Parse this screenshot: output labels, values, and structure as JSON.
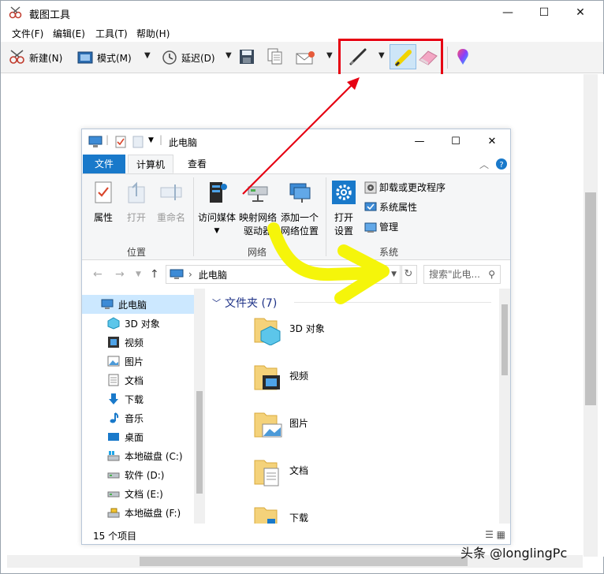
{
  "snip": {
    "title": "截图工具",
    "menu": [
      "文件(F)",
      "编辑(E)",
      "工具(T)",
      "帮助(H)"
    ],
    "toolbar": {
      "new_label": "新建(N)",
      "mode_label": "模式(M)",
      "delay_label": "延迟(D)"
    }
  },
  "explorer": {
    "title": "此电脑",
    "tabs": {
      "file": "文件",
      "computer": "计算机",
      "view": "查看"
    },
    "ribbon": {
      "properties": "属性",
      "open": "打开",
      "rename": "重命名",
      "group_location": "位置",
      "access_media_1": "访问媒体",
      "map_drive_1": "映射网络",
      "map_drive_2": "驱动器",
      "add_netloc_1": "添加一个",
      "add_netloc_2": "网络位置",
      "group_network": "网络",
      "open_settings_1": "打开",
      "open_settings_2": "设置",
      "uninstall": "卸载或更改程序",
      "sys_props": "系统属性",
      "manage": "管理",
      "group_system": "系统"
    },
    "address": "此电脑",
    "search_placeholder": "搜索\"此电...",
    "nav": [
      "此电脑",
      "3D 对象",
      "视频",
      "图片",
      "文档",
      "下载",
      "音乐",
      "桌面",
      "本地磁盘 (C:)",
      "软件 (D:)",
      "文档 (E:)",
      "本地磁盘 (F:)"
    ],
    "section_title": "文件夹 (7)",
    "folders": [
      "3D 对象",
      "视频",
      "图片",
      "文档",
      "下载"
    ],
    "status_count": "15 个项目"
  },
  "watermark": "头条 @longlingPc"
}
